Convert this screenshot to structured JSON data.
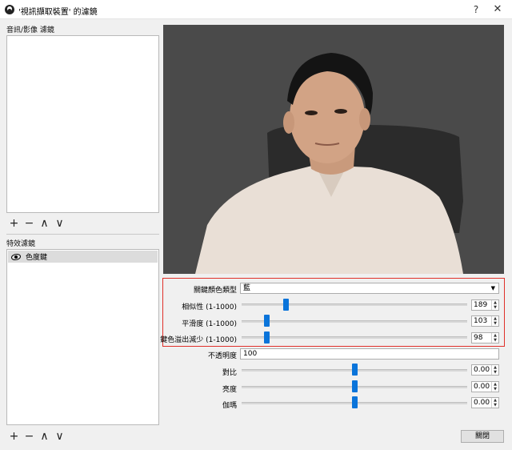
{
  "window": {
    "title": "'視訊擷取裝置' 的濾鏡",
    "help": "?",
    "close": "✕"
  },
  "audio_video_filters": {
    "label": "音訊/影像 濾鏡"
  },
  "effect_filters": {
    "label": "特效濾鏡",
    "items": [
      {
        "name": "色度鍵"
      }
    ]
  },
  "toolbar": {
    "add": "+",
    "remove": "−",
    "up": "∧",
    "down": "∨"
  },
  "properties": {
    "key_color_type": {
      "label": "關鍵顏色類型",
      "value": "藍"
    },
    "similarity": {
      "label": "相似性 (1-1000)",
      "value": "189",
      "min": 1,
      "max": 1000
    },
    "smoothness": {
      "label": "平滑度 (1-1000)",
      "value": "103",
      "min": 1,
      "max": 1000
    },
    "spill_reduction": {
      "label": "鍵色溢出減少 (1-1000)",
      "value": "98",
      "min": 1,
      "max": 1000
    },
    "opacity": {
      "label": "不透明度",
      "value": "100"
    },
    "contrast": {
      "label": "對比",
      "value": "0.00"
    },
    "brightness": {
      "label": "亮度",
      "value": "0.00"
    },
    "gamma": {
      "label": "伽瑪",
      "value": "0.00"
    }
  },
  "slider_levels": {
    "similarity": 0.19,
    "smoothness": 0.1,
    "spill_reduction": 0.1,
    "contrast": 0.5,
    "brightness": 0.5,
    "gamma": 0.5
  },
  "footer": {
    "close_label": "關閉"
  },
  "colors": {
    "accent": "#0a74da",
    "highlight": "#e0302a",
    "preview_bg": "#4a4a4a"
  }
}
